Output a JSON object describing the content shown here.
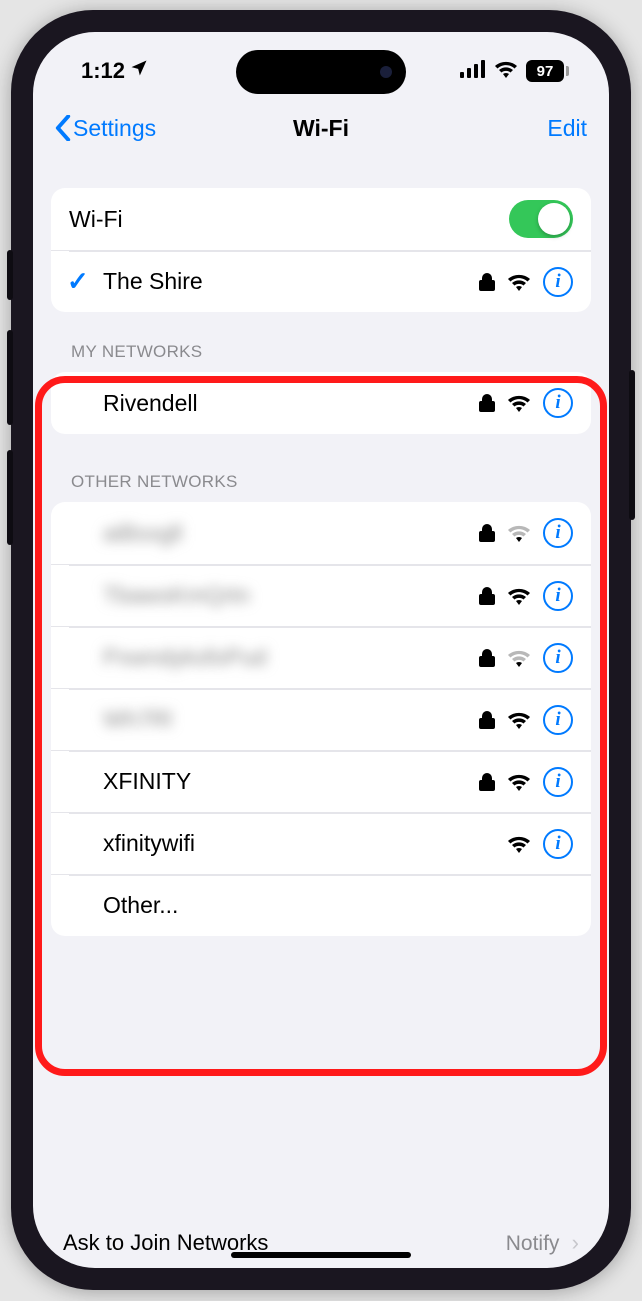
{
  "status": {
    "time": "1:12",
    "battery": "97"
  },
  "nav": {
    "back": "Settings",
    "title": "Wi-Fi",
    "edit": "Edit"
  },
  "wifi": {
    "toggle_label": "Wi-Fi",
    "connected": "The Shire"
  },
  "sections": {
    "my_header": "MY NETWORKS",
    "other_header": "OTHER NETWORKS"
  },
  "my_networks": [
    {
      "name": "Rivendell",
      "locked": true,
      "strength": "strong"
    }
  ],
  "other_networks": [
    {
      "name": "aiBsxgll",
      "locked": true,
      "strength": "weak",
      "blurred": true
    },
    {
      "name": "TbawsKmQrtn",
      "locked": true,
      "strength": "strong",
      "blurred": true
    },
    {
      "name": "PxwndyksfoPud",
      "locked": true,
      "strength": "weak",
      "blurred": true
    },
    {
      "name": "Wh7Rl",
      "locked": true,
      "strength": "strong",
      "blurred": true
    },
    {
      "name": "XFINITY",
      "locked": true,
      "strength": "strong",
      "blurred": false
    },
    {
      "name": "xfinitywifi",
      "locked": false,
      "strength": "strong",
      "blurred": false
    }
  ],
  "other_row": "Other...",
  "footer": {
    "label": "Ask to Join Networks",
    "value": "Notify"
  }
}
